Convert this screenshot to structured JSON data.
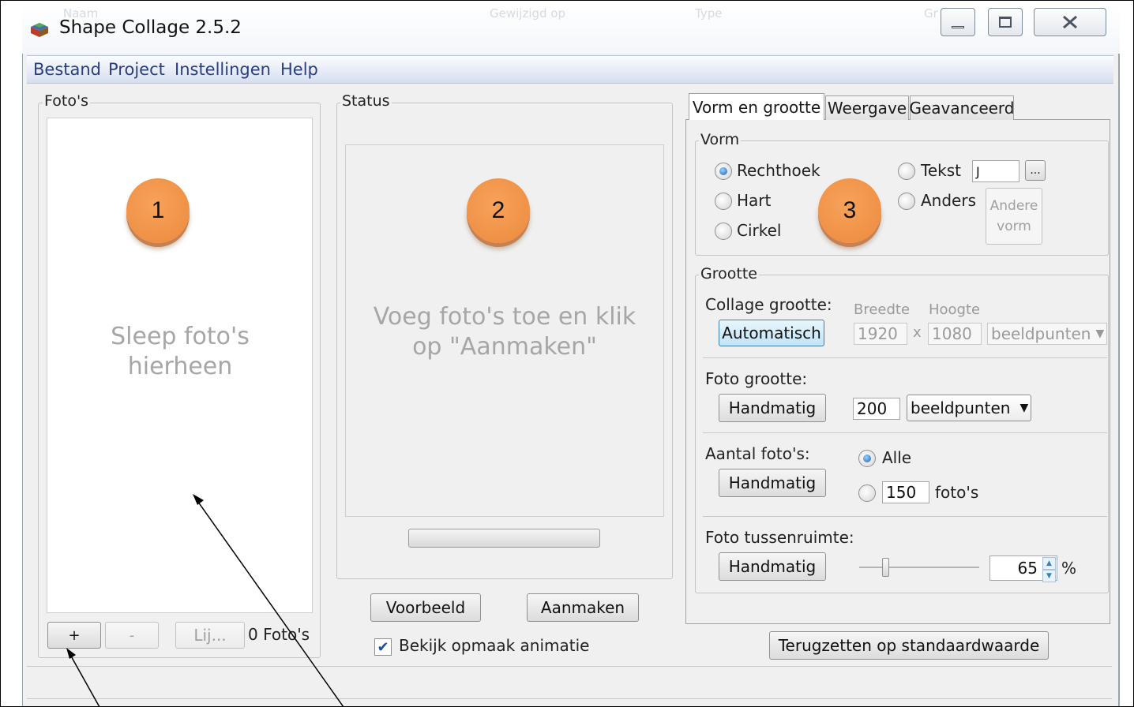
{
  "window": {
    "title": "Shape Collage 2.5.2",
    "bg_ghost_headers": [
      "Naam",
      "Gewijzigd op",
      "Type",
      "Gr"
    ]
  },
  "menu": [
    "Bestand",
    "Project",
    "Instellingen",
    "Help"
  ],
  "photos_panel": {
    "title": "Foto's",
    "drop_hint": "Sleep foto's hierheen",
    "add_label": "+",
    "remove_label": "-",
    "list_label": "Lij...",
    "count_label": "0 Foto's"
  },
  "status_panel": {
    "title": "Status",
    "hint": "Voeg foto's toe en klik op \"Aanmaken\"",
    "progress": 0,
    "preview_label": "Voorbeeld",
    "create_label": "Aanmaken",
    "animation_label": "Bekijk opmaak animatie",
    "animation_checked": true
  },
  "settings": {
    "tabs": [
      "Vorm en grootte",
      "Weergave",
      "Geavanceerd"
    ],
    "active_tab": 0,
    "shape": {
      "title": "Vorm",
      "options": [
        "Rechthoek",
        "Hart",
        "Cirkel"
      ],
      "selected": "Rechthoek",
      "text_label": "Tekst",
      "text_value": "J",
      "browse_label": "...",
      "other_label": "Anders",
      "other_shape_button": "Andere vorm"
    },
    "size": {
      "title": "Grootte",
      "collage_size_label": "Collage grootte:",
      "automatic_label": "Automatisch",
      "width_label": "Breedte",
      "height_label": "Hoogte",
      "width_value": "1920",
      "times": "x",
      "height_value": "1080",
      "unit": "beeldpunten",
      "photo_size_label": "Foto grootte:",
      "manual_label": "Handmatig",
      "photo_size_value": "200",
      "photo_size_unit": "beeldpunten",
      "photo_count_label": "Aantal foto's:",
      "all_label": "Alle",
      "count_value": "150",
      "count_unit": "foto's",
      "spacing_label": "Foto tussenruimte:",
      "spacing_value": "65",
      "spacing_unit": "%"
    },
    "reset_label": "Terugzetten op standaardwaarde"
  },
  "annotations": {
    "badge_1": "1",
    "badge_2": "2",
    "badge_3": "3"
  },
  "colors": {
    "menu_text": "#2a3f7a",
    "badge": "#ee8c3f",
    "hint_text": "#a6a6a6"
  }
}
